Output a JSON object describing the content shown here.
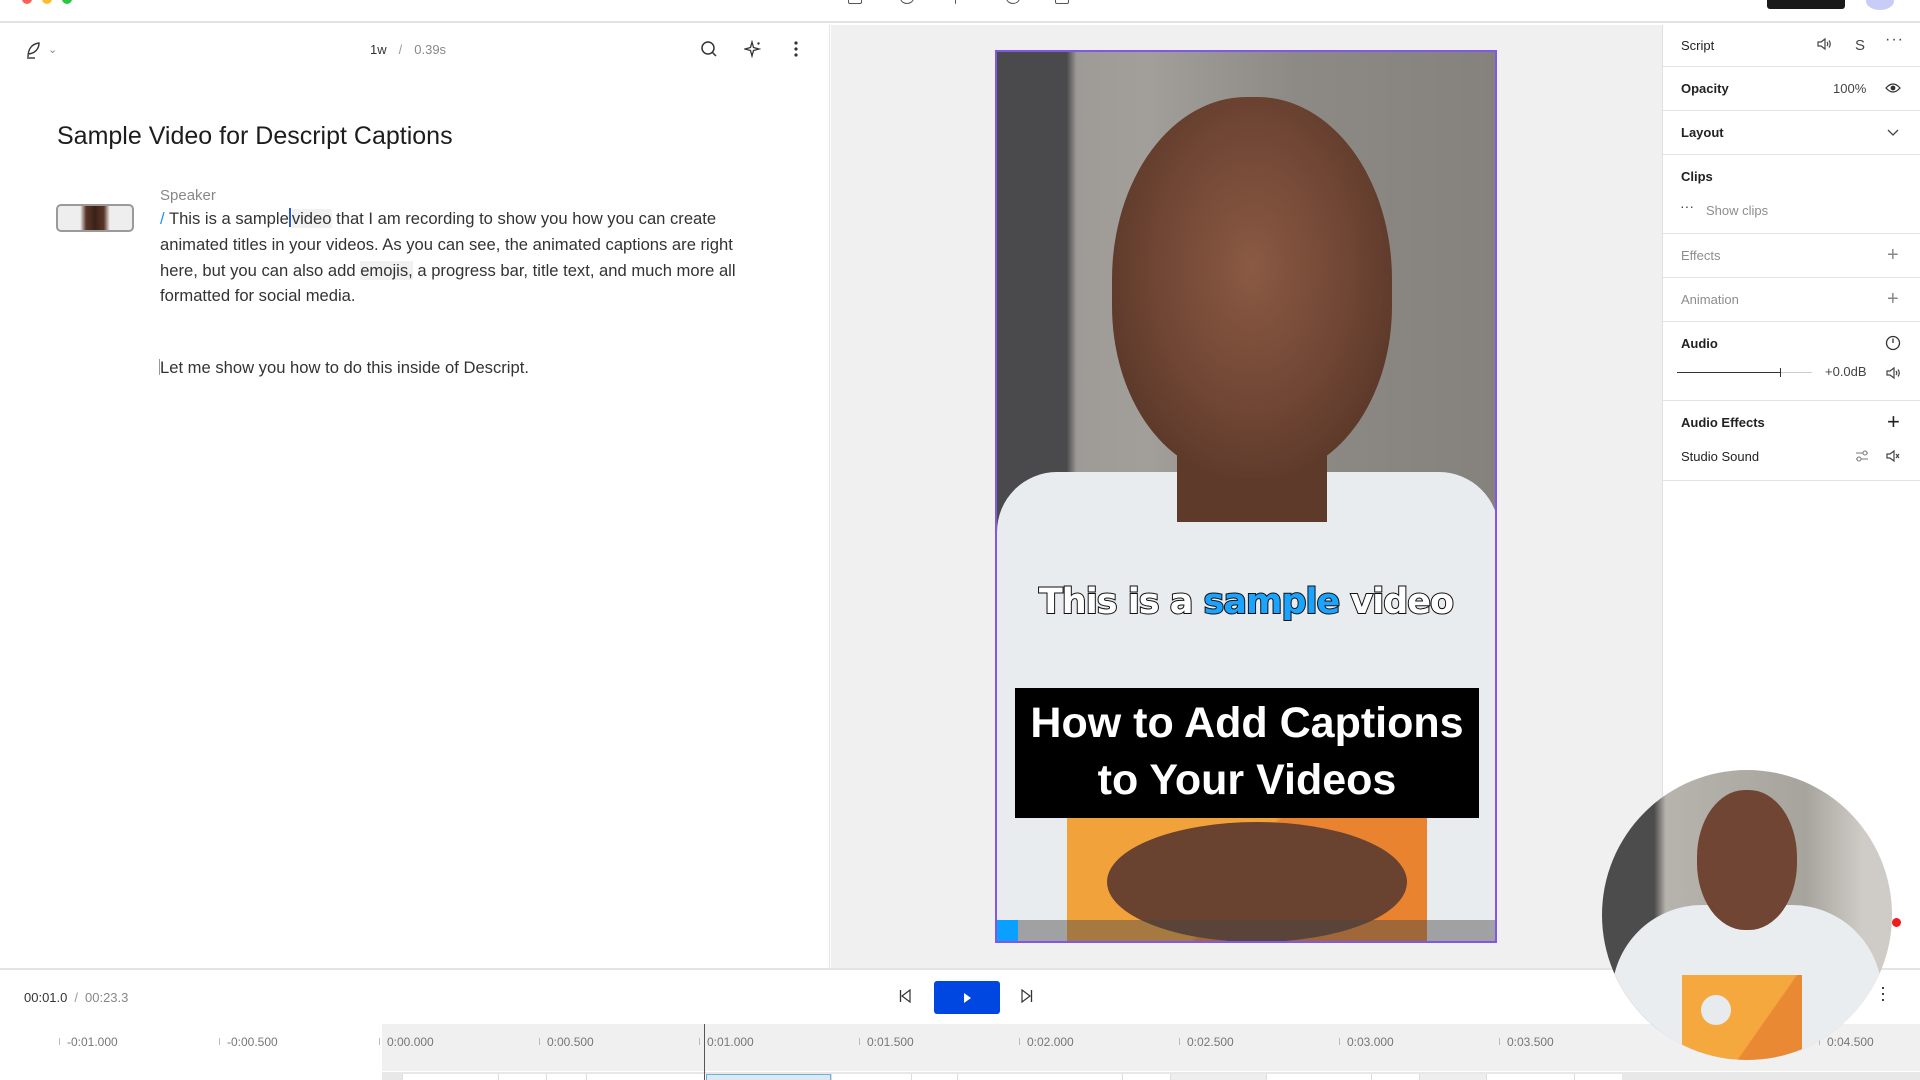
{
  "window": {
    "traffic_lights": [
      "#ff5f57",
      "#febc2e",
      "#28c840"
    ]
  },
  "script_toolbar": {
    "mode_icon": "feather-pen-icon",
    "word_count": "1w",
    "separator": "/",
    "duration": "0.39s",
    "icons": [
      "search-icon",
      "sparkle-ai-icon",
      "more-vertical-icon"
    ]
  },
  "document": {
    "title": "Sample Video for Descript Captions",
    "speaker_label": "Speaker",
    "paragraph1": {
      "marker": "/",
      "before_cursor": "This is a sample",
      "highlighted_word": "video",
      "after_highlight": " that I am recording to show you how you can create animated titles in your videos. As you can see, the animated captions are right here, but you can also add ",
      "highlighted_word2": "emojis,",
      "rest": " a progress bar, title text, and much more all formatted for social media."
    },
    "paragraph2": "Let me show you how to do this inside of Descript."
  },
  "preview": {
    "caption": {
      "before": "This is a ",
      "active_word": "sample",
      "after": " video"
    },
    "title_text_line1": "How to Add Captions",
    "title_text_line2": "to Your Videos",
    "progress_fraction": 0.043,
    "accent_color": "#1aa3ff",
    "selection_color": "#8257e5"
  },
  "properties": {
    "script": {
      "label": "Script",
      "icons": [
        "speaker-icon",
        "S",
        "more-horizontal-icon"
      ],
      "letter": "S"
    },
    "opacity": {
      "label": "Opacity",
      "value": "100%",
      "icon": "eye-icon"
    },
    "layout": {
      "label": "Layout",
      "icon": "chevron-down-icon"
    },
    "clips": {
      "label": "Clips",
      "show_clips": "Show clips"
    },
    "effects": {
      "label": "Effects"
    },
    "animation": {
      "label": "Animation"
    },
    "audio": {
      "label": "Audio",
      "gain": "+0.0dB",
      "slider_fraction": 0.76
    },
    "audio_effects": {
      "label": "Audio Effects",
      "items": [
        {
          "label": "Studio Sound"
        }
      ]
    }
  },
  "transport": {
    "current_time": "00:01.0",
    "separator": "/",
    "total_time": "00:23.3",
    "play_color": "#0046e0"
  },
  "timeline": {
    "ticks": [
      {
        "label": "-0:01.000",
        "t": -1.0
      },
      {
        "label": "-0:00.500",
        "t": -0.5
      },
      {
        "label": "0:00.000",
        "t": 0.0
      },
      {
        "label": "0:00.500",
        "t": 0.5
      },
      {
        "label": "0:01.000",
        "t": 1.0
      },
      {
        "label": "0:01.500",
        "t": 1.5
      },
      {
        "label": "0:02.000",
        "t": 2.0
      },
      {
        "label": "0:02.500",
        "t": 2.5
      },
      {
        "label": "0:03.000",
        "t": 3.0
      },
      {
        "label": "0:03.500",
        "t": 3.5
      },
      {
        "label": "0:04.500",
        "t": 4.5
      }
    ],
    "playhead_time": 1.0
  }
}
